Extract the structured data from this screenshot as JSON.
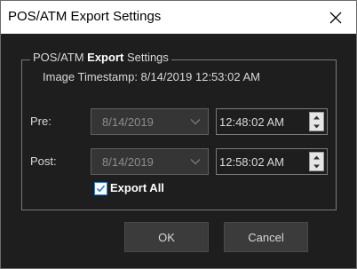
{
  "window": {
    "title": "POS/ATM Export Settings"
  },
  "group": {
    "legend_prefix": "POS/ATM ",
    "legend_bold": "Export",
    "legend_suffix": " Settings",
    "timestamp": "Image Timestamp: 8/14/2019 12:53:02 AM"
  },
  "pre": {
    "label": "Pre:",
    "date": "8/14/2019",
    "time": "12:48:02 AM"
  },
  "post": {
    "label": "Post:",
    "date": "8/14/2019",
    "time": "12:58:02 AM"
  },
  "export_all": {
    "label": "Export All",
    "checked": true
  },
  "buttons": {
    "ok": "OK",
    "cancel": "Cancel"
  },
  "icons": {
    "close": "close-icon",
    "dropdown": "chevron-down-icon",
    "spin_up": "spin-up-icon",
    "spin_down": "spin-down-icon",
    "check": "checkmark-icon"
  },
  "colors": {
    "background": "#1e1e1e",
    "titlebar": "#ffffff",
    "accent": "#2c7ad6"
  }
}
